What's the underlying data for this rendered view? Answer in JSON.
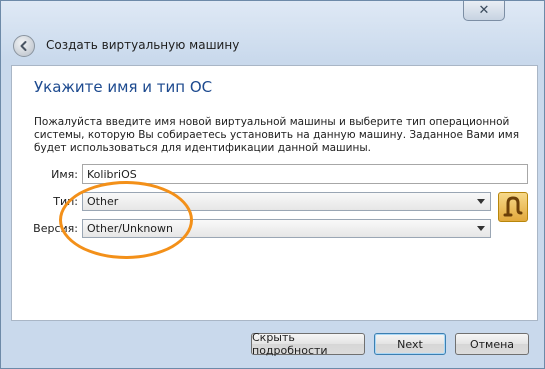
{
  "window": {
    "close_glyph": "✕"
  },
  "header": {
    "title": "Создать виртуальную машину"
  },
  "main": {
    "heading": "Укажите имя и тип ОС",
    "description": "Пожалуйста введите имя новой виртуальной машины и выберите тип операционной системы, которую Вы собираетесь установить на данную машину. Заданное Вами имя будет использоваться для идентификации данной машины.",
    "name_label": "Имя:",
    "name_value": "KolibriOS",
    "type_label": "Тип:",
    "type_value": "Other",
    "version_label": "Версия:",
    "version_value": "Other/Unknown",
    "os_icon": "other-os-icon"
  },
  "footer": {
    "details_label": "Скрыть подробности",
    "next_label": "Next",
    "cancel_label": "Отмена"
  },
  "colors": {
    "heading": "#1d4a8f",
    "annotation": "#f39019"
  }
}
